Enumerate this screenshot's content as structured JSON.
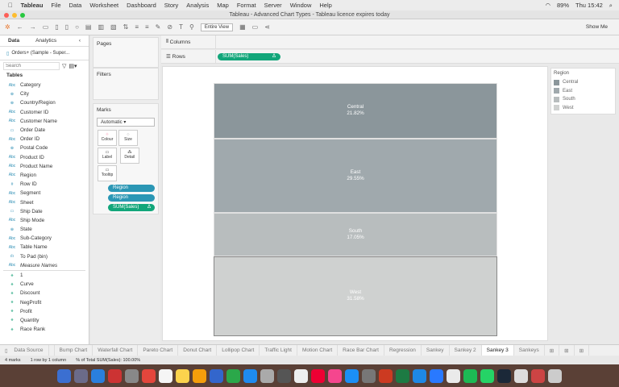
{
  "menubar": {
    "app": "Tableau",
    "items": [
      "File",
      "Data",
      "Worksheet",
      "Dashboard",
      "Story",
      "Analysis",
      "Map",
      "Format",
      "Server",
      "Window",
      "Help"
    ],
    "battery": "89%",
    "clock": "Thu 15:42"
  },
  "window": {
    "title": "Tableau - Advanced Chart Types - Tableau licence expires today"
  },
  "toolbar": {
    "fit": "Entire View",
    "show_me": "Show Me"
  },
  "left": {
    "tab_data": "Data",
    "tab_analytics": "Analytics",
    "datasource": "Orders+ (Sample - Super...",
    "search_placeholder": "Search",
    "tables_heading": "Tables",
    "dimensions": [
      {
        "icon": "Abc",
        "name": "Category"
      },
      {
        "icon": "globe",
        "name": "City"
      },
      {
        "icon": "globe",
        "name": "Country/Region"
      },
      {
        "icon": "Abc",
        "name": "Customer ID"
      },
      {
        "icon": "Abc",
        "name": "Customer Name"
      },
      {
        "icon": "date",
        "name": "Order Date"
      },
      {
        "icon": "Abc",
        "name": "Order ID"
      },
      {
        "icon": "globe",
        "name": "Postal Code"
      },
      {
        "icon": "Abc",
        "name": "Product ID"
      },
      {
        "icon": "Abc",
        "name": "Product Name"
      },
      {
        "icon": "Abc",
        "name": "Region"
      },
      {
        "icon": "#",
        "name": "Row ID"
      },
      {
        "icon": "Abc",
        "name": "Segment"
      },
      {
        "icon": "Abc",
        "name": "Sheet"
      },
      {
        "icon": "date",
        "name": "Ship Date"
      },
      {
        "icon": "Abc",
        "name": "Ship Mode"
      },
      {
        "icon": "globe",
        "name": "State"
      },
      {
        "icon": "Abc",
        "name": "Sub-Category"
      },
      {
        "icon": "Abc",
        "name": "Table Name"
      },
      {
        "icon": "bin",
        "name": "To Pad (bin)"
      },
      {
        "icon": "Abc",
        "name": "Measure Names"
      }
    ],
    "measures": [
      {
        "icon": "#",
        "name": "1"
      },
      {
        "icon": "#",
        "name": "Curve"
      },
      {
        "icon": "#",
        "name": "Discount"
      },
      {
        "icon": "#",
        "name": "NegProfit"
      },
      {
        "icon": "#",
        "name": "Profit"
      },
      {
        "icon": "#",
        "name": "Quantity"
      },
      {
        "icon": "#",
        "name": "Race Rank"
      }
    ]
  },
  "cards": {
    "pages": "Pages",
    "filters": "Filters",
    "marks": "Marks",
    "mark_type": "Automatic",
    "buttons": [
      "Colour",
      "Size",
      "Label",
      "Detail",
      "Tooltip"
    ],
    "pills": [
      {
        "label": "Region",
        "color": "#2b97b5"
      },
      {
        "label": "Region",
        "color": "#2b97b5"
      },
      {
        "label": "SUM(Sales)",
        "color": "#12a67a",
        "delta": "Δ"
      }
    ]
  },
  "shelves": {
    "columns": "Columns",
    "rows": "Rows",
    "rows_pill": "SUM(Sales)",
    "rows_pill_delta": "Δ"
  },
  "legend": {
    "title": "Region",
    "items": [
      {
        "label": "Central",
        "color": "#8b969b"
      },
      {
        "label": "East",
        "color": "#a0a9ad"
      },
      {
        "label": "South",
        "color": "#b8bdbe"
      },
      {
        "label": "West",
        "color": "#cfd1d0"
      }
    ]
  },
  "chart_data": {
    "type": "bar",
    "stacked": true,
    "categories": [
      "Central",
      "East",
      "South",
      "West"
    ],
    "values": [
      21.82,
      29.55,
      17.05,
      31.58
    ],
    "labels": [
      "21.82%",
      "29.55%",
      "17.05%",
      "31.58%"
    ],
    "colors": [
      "#8b969b",
      "#a0a9ad",
      "#b8bdbe",
      "#cfd1d0"
    ]
  },
  "tabs": {
    "datasource": "Data Source",
    "sheets": [
      "Bump Chart",
      "Waterfall Chart",
      "Pareto Chart",
      "Donut Chart",
      "Lollipop Chart",
      "Traffic Light",
      "Motion Chart",
      "Race Bar Chart",
      "Regression",
      "Sankey",
      "Sankey 2",
      "Sankey 3",
      "Sankeys"
    ],
    "active": "Sankey 3"
  },
  "status": {
    "marks": "4 marks",
    "rows": "1 row by 1 column",
    "total": "% of Total SUM(Sales): 100.00%"
  }
}
